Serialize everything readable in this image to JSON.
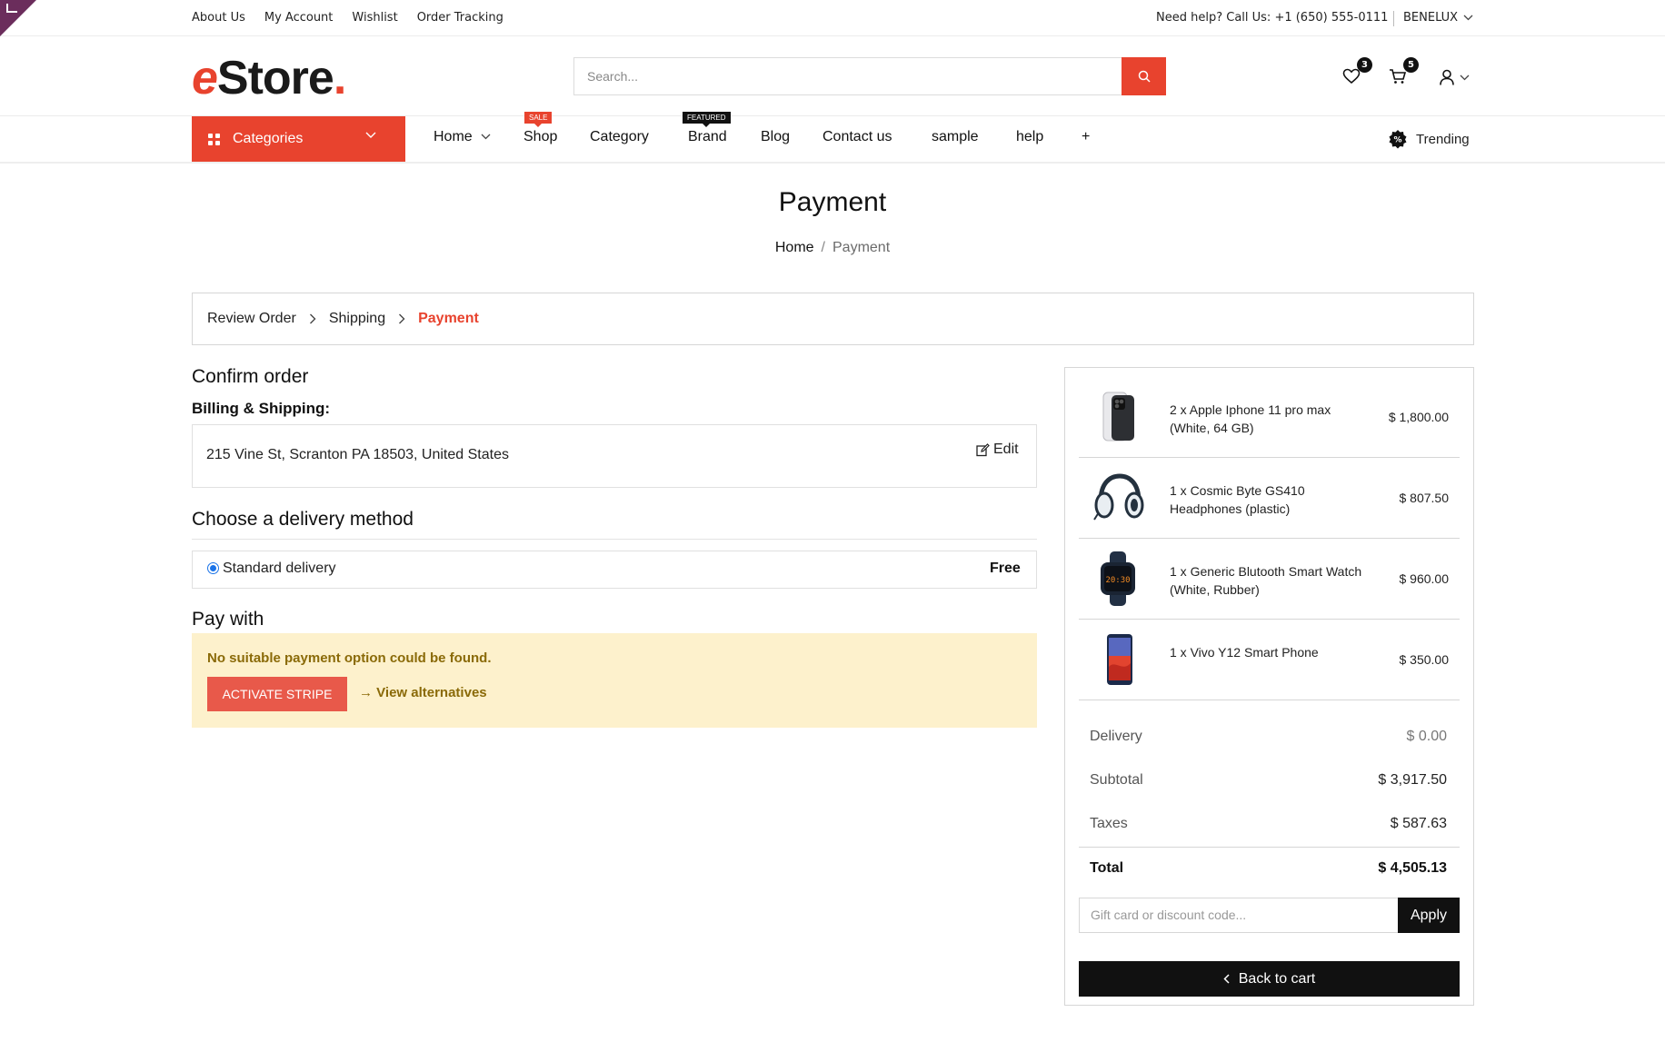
{
  "topbar": {
    "links": [
      "About Us",
      "My Account",
      "Wishlist",
      "Order Tracking"
    ],
    "help": "Need help? Call Us: +1 (650) 555-0111",
    "language": "BENELUX"
  },
  "header": {
    "logo_e": "e",
    "logo_rest": "Store",
    "logo_dot": ".",
    "search_placeholder": "Search...",
    "wishlist_count": "3",
    "cart_count": "5"
  },
  "nav": {
    "categories_label": "Categories",
    "items": [
      "Home",
      "Shop",
      "Category",
      "Brand",
      "Blog",
      "Contact us",
      "sample",
      "help",
      "+"
    ],
    "sale_tag": "SALE",
    "featured_tag": "FEATURED",
    "trending": "Trending"
  },
  "page": {
    "title": "Payment",
    "breadcrumb_home": "Home",
    "breadcrumb_sep": "/",
    "breadcrumb_current": "Payment"
  },
  "steps": [
    "Review Order",
    "Shipping",
    "Payment"
  ],
  "confirm": {
    "heading": "Confirm order",
    "billing_heading": "Billing & Shipping:",
    "address": "215 Vine St, Scranton PA 18503, United States",
    "edit_label": "Edit"
  },
  "delivery": {
    "heading": "Choose a delivery method",
    "method": "Standard delivery",
    "price": "Free"
  },
  "pay": {
    "heading": "Pay with",
    "warning": "No suitable payment option could be found.",
    "activate_label": "ACTIVATE STRIPE",
    "alternatives_label": "→ View alternatives"
  },
  "order_items": [
    {
      "name": "2 x Apple Iphone 11 pro max (White, 64 GB)",
      "price": "$ 1,800.00",
      "icon": "phone-image"
    },
    {
      "name": "1 x Cosmic Byte GS410 Headphones (plastic)",
      "price": "$ 807.50",
      "icon": "headphones-image"
    },
    {
      "name": "1 x Generic Blutooth Smart Watch (White, Rubber)",
      "price": "$ 960.00",
      "icon": "smartwatch-image"
    },
    {
      "name": "1 x Vivo Y12 Smart Phone",
      "price": "$ 350.00",
      "icon": "phone-image"
    }
  ],
  "watch_time": "20:30",
  "summary": {
    "delivery_label": "Delivery",
    "delivery_value": "$ 0.00",
    "subtotal_label": "Subtotal",
    "subtotal_value": "$ 3,917.50",
    "taxes_label": "Taxes",
    "taxes_value": "$ 587.63",
    "total_label": "Total",
    "total_value": "$ 4,505.13",
    "coupon_placeholder": "Gift card or discount code...",
    "apply_label": "Apply",
    "back_label": "Back to cart"
  },
  "colors": {
    "accent": "#e8432e",
    "dark": "#111111",
    "warning_bg": "#fdf1cc",
    "warning_text": "#8a6a08"
  }
}
